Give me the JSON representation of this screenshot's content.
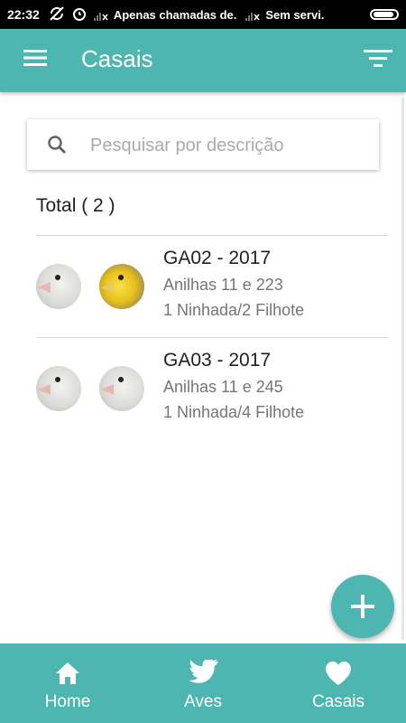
{
  "status_bar": {
    "time": "22:32",
    "carrier_1": "Apenas chamadas de.",
    "carrier_2": "Sem servi."
  },
  "app_bar": {
    "title": "Casais",
    "menu_icon": "hamburger-menu-icon",
    "filter_icon": "filter-icon"
  },
  "search": {
    "placeholder": "Pesquisar por descrição",
    "value": "",
    "icon": "search-icon"
  },
  "total_label": "Total ( 2 )",
  "couples": [
    {
      "title": "GA02 - 2017",
      "rings": "Anilhas 11 e 223",
      "brood": "1 Ninhada/2 Filhote",
      "avatars": [
        "white-bird",
        "yellow-bird"
      ]
    },
    {
      "title": "GA03 - 2017",
      "rings": "Anilhas 11 e 245",
      "brood": "1 Ninhada/4 Filhote",
      "avatars": [
        "white-bird",
        "white-bird"
      ]
    }
  ],
  "fab_icon": "plus-icon",
  "bottom_nav": [
    {
      "label": "Home",
      "icon": "home-icon"
    },
    {
      "label": "Aves",
      "icon": "bird-icon"
    },
    {
      "label": "Casais",
      "icon": "heart-icon"
    }
  ],
  "colors": {
    "primary": "#4db6b0",
    "status_bar": "#000000",
    "text_primary": "#212121",
    "text_secondary": "#757575"
  }
}
